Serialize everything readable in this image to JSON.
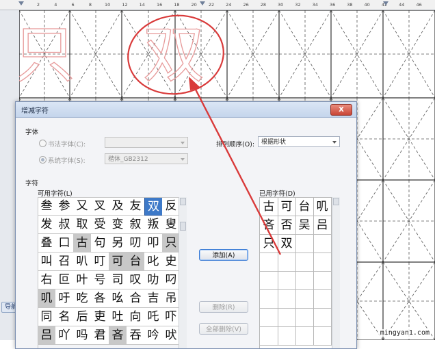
{
  "ruler": {
    "ticks": [
      "2",
      "4",
      "6",
      "8",
      "10",
      "12",
      "14",
      "16",
      "18",
      "20",
      "22",
      "24",
      "26",
      "28",
      "30",
      "32",
      "34",
      "36",
      "38",
      "40",
      "42",
      "44",
      "46"
    ]
  },
  "document": {
    "sample_chars": [
      "只",
      "双"
    ]
  },
  "sidebar": {
    "tab_label": "导航"
  },
  "dialog": {
    "title": "增减字符",
    "font_section": {
      "label": "字体",
      "calligraphy_radio": "书法字体(C):",
      "calligraphy_value": "",
      "system_radio": "系统字体(S):",
      "system_value": "楷体_GB2312"
    },
    "sort": {
      "label": "排列顺序(O):",
      "value": "根据形状"
    },
    "chars_section": {
      "label": "字符",
      "available_label": "可用字符(L)",
      "available": [
        [
          "叁",
          "参",
          "又",
          "叉",
          "及",
          "友",
          "双",
          "反"
        ],
        [
          "发",
          "叔",
          "取",
          "受",
          "变",
          "叙",
          "叛",
          "叟"
        ],
        [
          "叠",
          "口",
          "古",
          "句",
          "另",
          "叨",
          "叩",
          "只"
        ],
        [
          "叫",
          "召",
          "叭",
          "叮",
          "可",
          "台",
          "叱",
          "史"
        ],
        [
          "右",
          "叵",
          "叶",
          "号",
          "司",
          "叹",
          "叻",
          "叼"
        ],
        [
          "叽",
          "吁",
          "吃",
          "各",
          "吆",
          "合",
          "吉",
          "吊"
        ],
        [
          "同",
          "名",
          "后",
          "吏",
          "吐",
          "向",
          "吒",
          "吓"
        ],
        [
          "吕",
          "吖",
          "吗",
          "君",
          "吝",
          "吞",
          "吟",
          "吠"
        ]
      ],
      "used_label": "已用字符(D)",
      "used": [
        [
          "古",
          "可",
          "台",
          "叽"
        ],
        [
          "吝",
          "否",
          "吴",
          "吕"
        ],
        [
          "只",
          "双",
          "",
          ""
        ]
      ]
    },
    "buttons": {
      "add": "添加(A)",
      "delete": "删除(R)",
      "delete_all": "全部删除(V)"
    },
    "close": "X"
  },
  "watermark": "mingyan1.com",
  "colors": {
    "annotation": "#d93a3a",
    "selection": "#3d79c8",
    "used_cell": "#c8c8c8"
  }
}
